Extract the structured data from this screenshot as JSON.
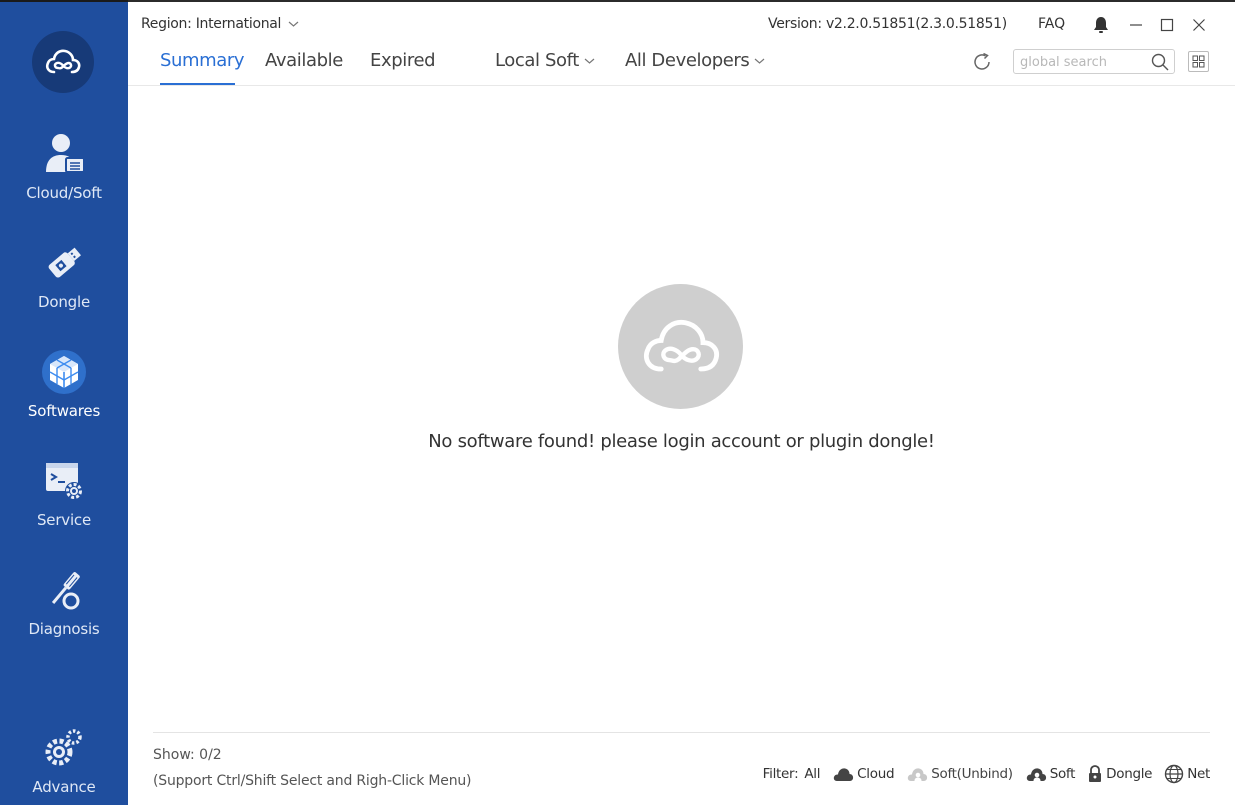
{
  "header": {
    "region": "Region: International",
    "version": "Version: v2.2.0.51851(2.3.0.51851)",
    "faq": "FAQ"
  },
  "sidebar": {
    "items": [
      {
        "label": "Cloud/Soft",
        "icon": "user-card-icon"
      },
      {
        "label": "Dongle",
        "icon": "usb-dongle-icon"
      },
      {
        "label": "Softwares",
        "icon": "cubes-icon",
        "active": true
      },
      {
        "label": "Service",
        "icon": "terminal-gear-icon"
      },
      {
        "label": "Diagnosis",
        "icon": "screwdriver-icon"
      },
      {
        "label": "Advance",
        "icon": "gears-icon"
      }
    ]
  },
  "tabs": [
    {
      "label": "Summary",
      "active": true
    },
    {
      "label": "Available"
    },
    {
      "label": "Expired"
    }
  ],
  "dropdowns": {
    "local_soft": "Local Soft",
    "all_developers": "All Developers"
  },
  "search": {
    "placeholder": "global search"
  },
  "main": {
    "empty_message": "No software found! please login account or plugin dongle!"
  },
  "footer": {
    "show": "Show: 0/2",
    "hint": "(Support Ctrl/Shift Select and Righ-Click Menu)",
    "filter_label": "Filter:",
    "filters": [
      "All",
      "Cloud",
      "Soft(Unbind)",
      "Soft",
      "Dongle",
      "Net"
    ]
  },
  "colors": {
    "sidebar": "#1f4e9e",
    "accent": "#2a6fd4",
    "empty_logo": "#cfcfcf"
  }
}
